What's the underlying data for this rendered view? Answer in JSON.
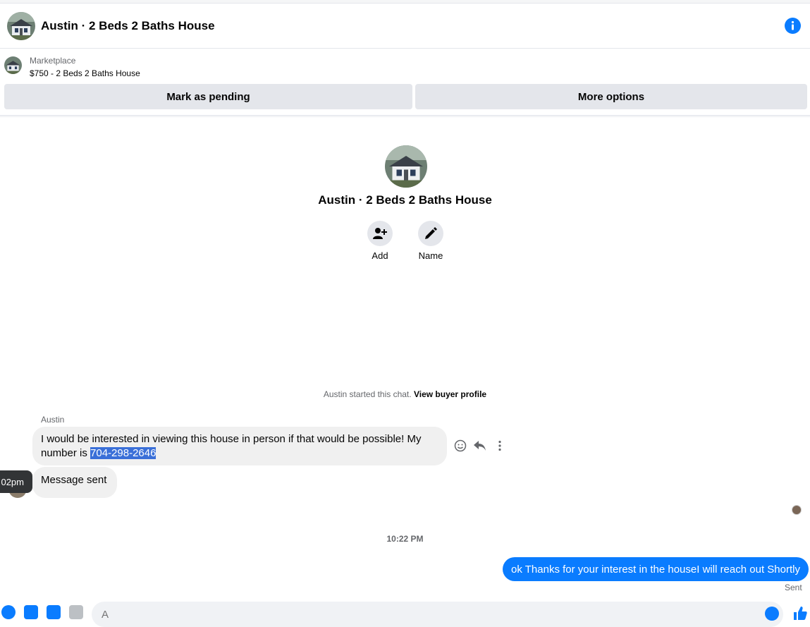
{
  "header": {
    "title": "Austin · 2 Beds 2 Baths House",
    "info_icon": "info-icon"
  },
  "marketplace": {
    "label": "Marketplace",
    "listing": "$750 - 2 Beds 2 Baths House"
  },
  "actions": {
    "pending_label": "Mark as pending",
    "more_label": "More options"
  },
  "profile": {
    "name": "Austin · 2 Beds 2 Baths House",
    "add_label": "Add",
    "name_label": "Name"
  },
  "chat": {
    "started_text": "Austin started this chat.",
    "view_profile_link": "View buyer profile",
    "sender": "Austin",
    "incoming_text": "I would be interested in viewing this house in person if that would be possible! My number is ",
    "incoming_phone": "704-298-2646",
    "sent_note": "Message sent",
    "tooltip_time": "02pm",
    "timestamp": "10:22 PM",
    "outgoing_text": "ok Thanks for your interest in the houseI will reach out Shortly",
    "outgoing_status": "Sent"
  },
  "composer": {
    "placeholder": "A"
  },
  "colors": {
    "accent": "#0a7cff",
    "bubble_gray": "#f0f0f0",
    "button_gray": "#e4e6eb"
  }
}
